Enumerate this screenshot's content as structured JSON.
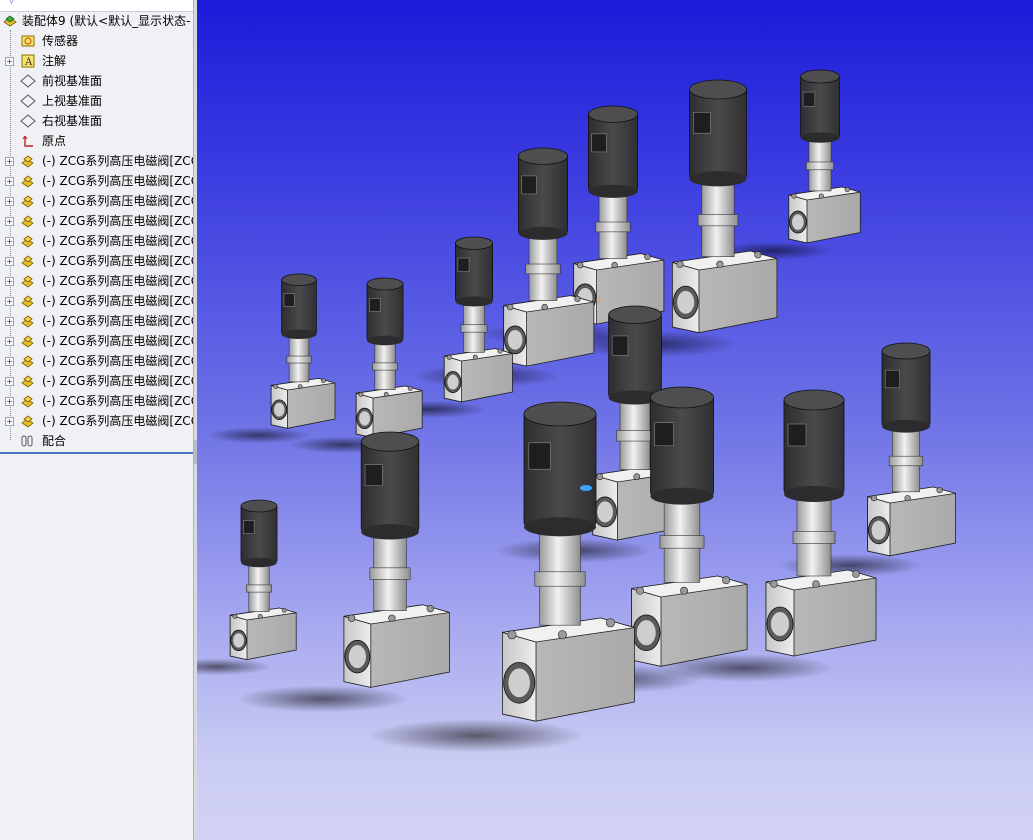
{
  "feature_tree": {
    "root_label": "装配体9 (默认<默认_显示状态-",
    "items": [
      {
        "label": "传感器",
        "icon": "sensor-icon",
        "expandable": false
      },
      {
        "label": "注解",
        "icon": "annotation-icon",
        "expandable": true
      },
      {
        "label": "前视基准面",
        "icon": "plane-icon",
        "expandable": false
      },
      {
        "label": "上视基准面",
        "icon": "plane-icon",
        "expandable": false
      },
      {
        "label": "右视基准面",
        "icon": "plane-icon",
        "expandable": false
      },
      {
        "label": "原点",
        "icon": "origin-icon",
        "expandable": false
      },
      {
        "label": "(-) ZCG系列高压电磁阀[ZCG",
        "icon": "part-icon",
        "expandable": true
      },
      {
        "label": "(-) ZCG系列高压电磁阀[ZCG",
        "icon": "part-icon",
        "expandable": true
      },
      {
        "label": "(-) ZCG系列高压电磁阀[ZCG",
        "icon": "part-icon",
        "expandable": true
      },
      {
        "label": "(-) ZCG系列高压电磁阀[ZCG",
        "icon": "part-icon",
        "expandable": true
      },
      {
        "label": "(-) ZCG系列高压电磁阀[ZCG",
        "icon": "part-icon",
        "expandable": true
      },
      {
        "label": "(-) ZCG系列高压电磁阀[ZCG",
        "icon": "part-icon",
        "expandable": true
      },
      {
        "label": "(-) ZCG系列高压电磁阀[ZCG",
        "icon": "part-icon",
        "expandable": true
      },
      {
        "label": "(-) ZCG系列高压电磁阀[ZCG",
        "icon": "part-icon",
        "expandable": true
      },
      {
        "label": "(-) ZCG系列高压电磁阀[ZCG",
        "icon": "part-icon",
        "expandable": true
      },
      {
        "label": "(-) ZCG系列高压电磁阀[ZCG",
        "icon": "part-icon",
        "expandable": true
      },
      {
        "label": "(-) ZCG系列高压电磁阀[ZCG",
        "icon": "part-icon",
        "expandable": true
      },
      {
        "label": "(-) ZCG系列高压电磁阀[ZCG",
        "icon": "part-icon",
        "expandable": true
      },
      {
        "label": "(-) ZCG系列高压电磁阀[ZCG",
        "icon": "part-icon",
        "expandable": true
      },
      {
        "label": "(-) ZCG系列高压电磁阀[ZCG",
        "icon": "part-icon",
        "expandable": true
      },
      {
        "label": "配合",
        "icon": "mates-icon",
        "expandable": false
      }
    ]
  },
  "viewport": {
    "scene": "assembly-of-14-solenoid-valves",
    "background_top": "#1b1bd9",
    "background_bottom": "#d2d3f3",
    "body_color": "#d9d9d9",
    "coil_color": "#3c3c3e",
    "stem_color": "#c6c6c6"
  }
}
